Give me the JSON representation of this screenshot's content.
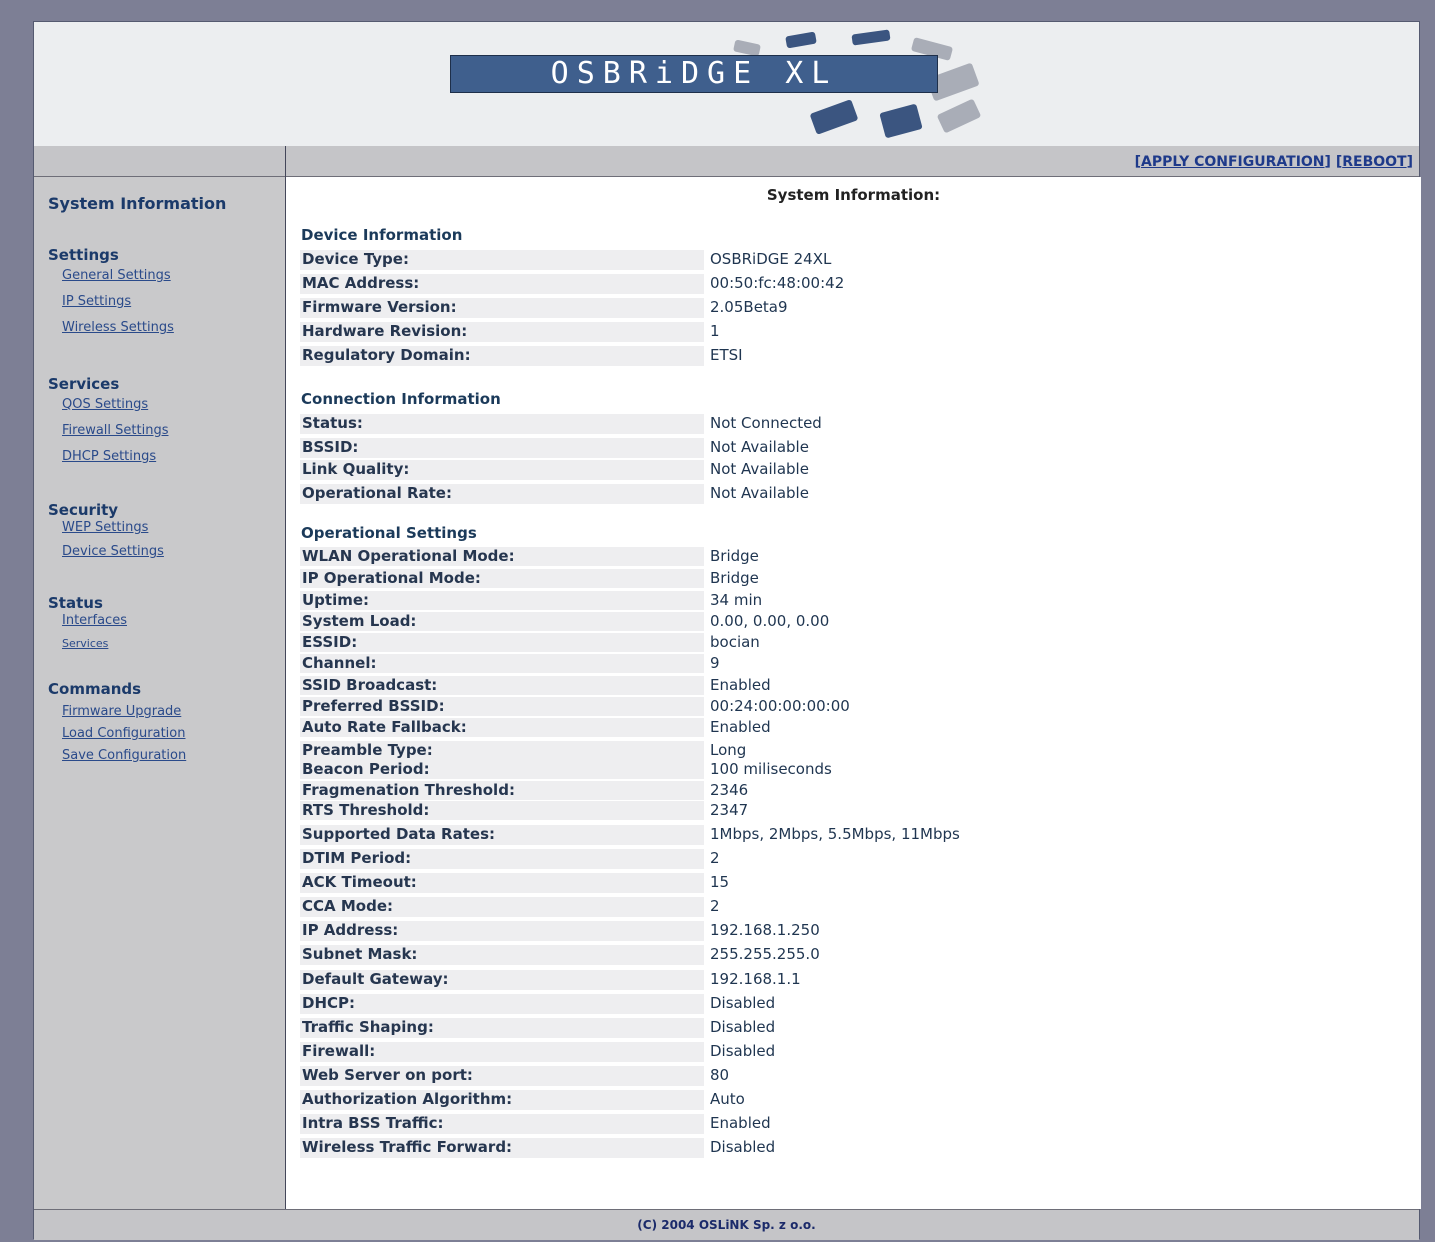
{
  "banner": {
    "logo_text": "OSBRiDGE XL"
  },
  "toplinks": {
    "apply": "APPLY CONFIGURATION",
    "reboot": "REBOOT",
    "open": "[",
    "close": "]",
    "sep": " "
  },
  "sidebar": {
    "system_information": "System Information",
    "groups": [
      {
        "title": "Settings",
        "links": [
          "General Settings",
          "IP Settings",
          "Wireless Settings"
        ]
      },
      {
        "title": "Services",
        "links": [
          "QOS Settings",
          "Firewall Settings",
          "DHCP Settings"
        ]
      },
      {
        "title": "Security",
        "links": [
          "WEP Settings",
          "Device Settings"
        ]
      },
      {
        "title": "Status",
        "links": [
          "Interfaces",
          "Services"
        ]
      },
      {
        "title": "Commands",
        "links": [
          "Firmware Upgrade",
          "Load Configuration",
          "Save Configuration"
        ]
      }
    ]
  },
  "main": {
    "title": "System Information:",
    "device_information": {
      "title": "Device Information",
      "rows": [
        {
          "label": "Device Type:",
          "value": "OSBRiDGE 24XL"
        },
        {
          "label": "MAC Address:",
          "value": "00:50:fc:48:00:42"
        },
        {
          "label": "Firmware Version:",
          "value": "2.05Beta9"
        },
        {
          "label": "Hardware Revision:",
          "value": "1"
        },
        {
          "label": "Regulatory Domain:",
          "value": "ETSI"
        }
      ]
    },
    "connection_information": {
      "title": "Connection Information",
      "rows": [
        {
          "label": "Status:",
          "value": "Not Connected"
        },
        {
          "label": "BSSID:",
          "value": "Not Available"
        },
        {
          "label": "Link Quality:",
          "value": "Not Available"
        },
        {
          "label": "Operational Rate:",
          "value": "Not Available"
        }
      ]
    },
    "operational_settings": {
      "title": "Operational Settings",
      "rows": [
        {
          "label": "WLAN Operational Mode:",
          "value": "Bridge"
        },
        {
          "label": "IP Operational Mode:",
          "value": "Bridge"
        },
        {
          "label": "Uptime:",
          "value": "34 min"
        },
        {
          "label": "System Load:",
          "value": "0.00, 0.00, 0.00"
        },
        {
          "label": "ESSID:",
          "value": "bocian"
        },
        {
          "label": "Channel:",
          "value": "9"
        },
        {
          "label": "SSID Broadcast:",
          "value": "Enabled"
        },
        {
          "label": "Preferred BSSID:",
          "value": "00:24:00:00:00:00"
        },
        {
          "label": "Auto Rate Fallback:",
          "value": "Enabled"
        },
        {
          "label": "Preamble Type:",
          "value": "Long"
        },
        {
          "label": "Beacon Period:",
          "value": "100 miliseconds"
        },
        {
          "label": "Fragmenation Threshold:",
          "value": "2346"
        },
        {
          "label": "RTS Threshold:",
          "value": "2347"
        },
        {
          "label": "Supported Data Rates:",
          "value": "1Mbps, 2Mbps, 5.5Mbps, 11Mbps"
        },
        {
          "label": "DTIM Period:",
          "value": "2"
        },
        {
          "label": "ACK Timeout:",
          "value": "15"
        },
        {
          "label": "CCA Mode:",
          "value": "2"
        },
        {
          "label": "IP Address:",
          "value": "192.168.1.250"
        },
        {
          "label": "Subnet Mask:",
          "value": "255.255.255.0"
        },
        {
          "label": "Default Gateway:",
          "value": "192.168.1.1"
        },
        {
          "label": "DHCP:",
          "value": "Disabled"
        },
        {
          "label": "Traffic Shaping:",
          "value": "Disabled"
        },
        {
          "label": "Firewall:",
          "value": "Disabled"
        },
        {
          "label": "Web Server on port:",
          "value": "80"
        },
        {
          "label": "Authorization Algorithm:",
          "value": "Auto"
        },
        {
          "label": "Intra BSS Traffic:",
          "value": "Enabled"
        },
        {
          "label": "Wireless Traffic Forward:",
          "value": "Disabled"
        }
      ]
    }
  },
  "footer": {
    "text": "(C) 2004 OSLiNK Sp. z o.o."
  }
}
